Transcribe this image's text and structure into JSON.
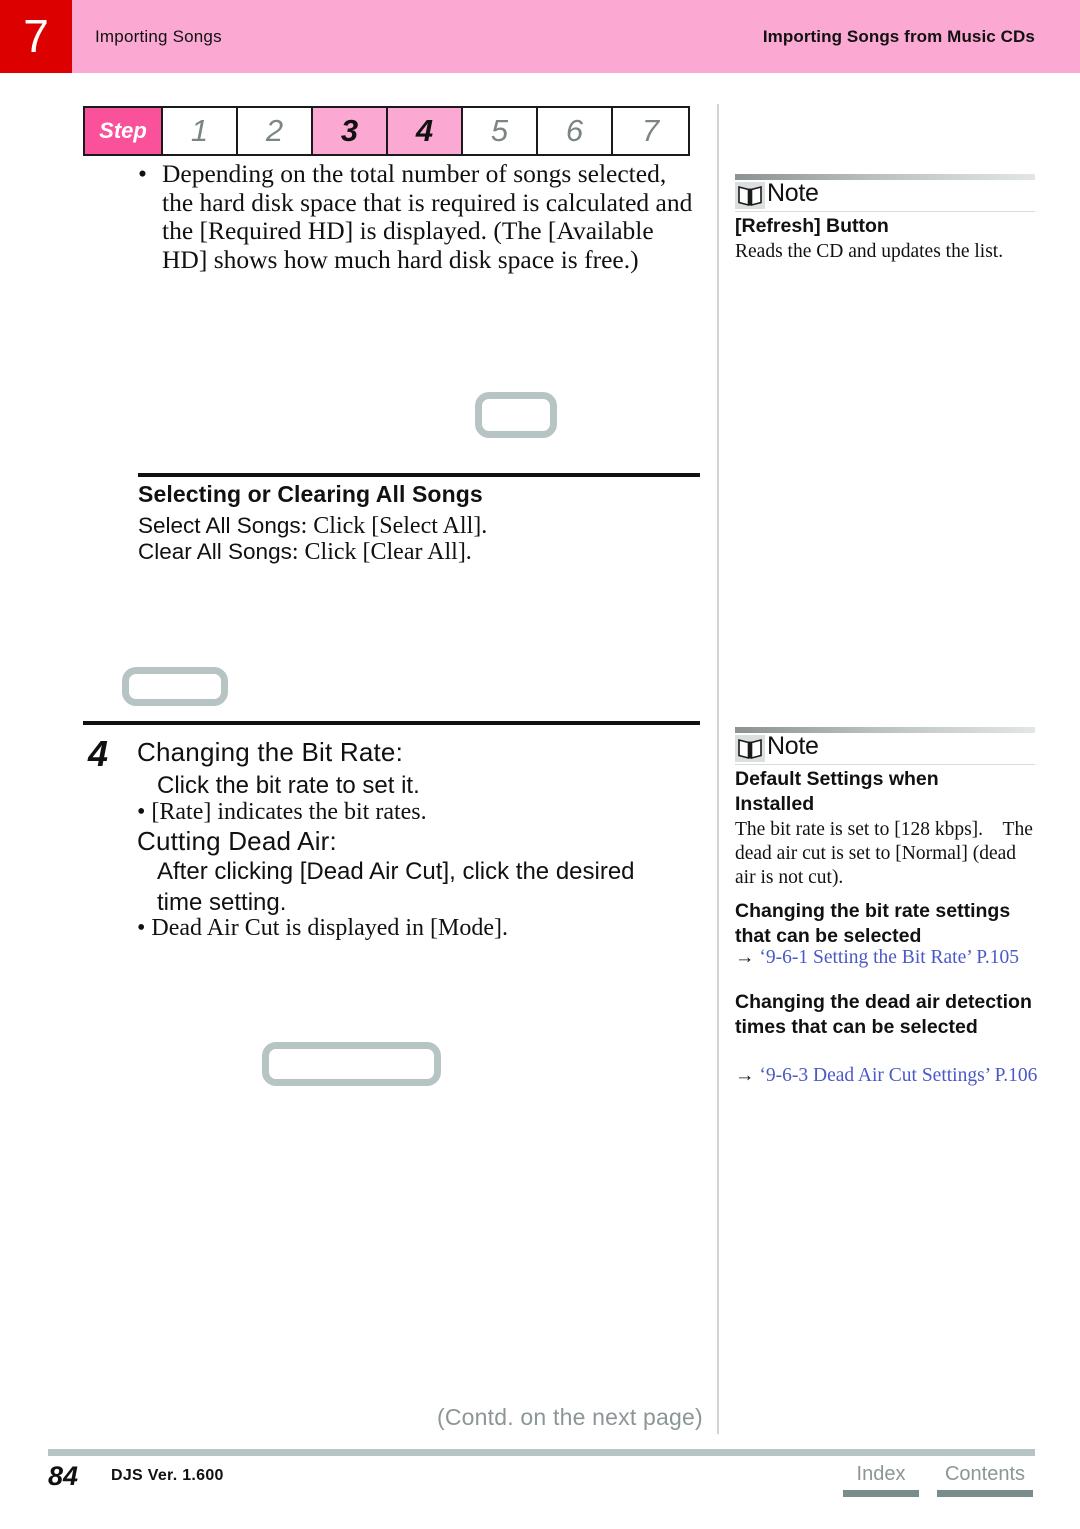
{
  "header": {
    "chapter_number": "7",
    "left_title": "Importing Songs",
    "right_title": "Importing Songs from Music CDs",
    "band_color": "#fba9d2",
    "chapter_box_color": "#dd0000"
  },
  "step_bar": {
    "label": "Step",
    "label_color": "#f9529b",
    "active_color": "#fba9d2",
    "steps": [
      {
        "number": "1",
        "active": false
      },
      {
        "number": "2",
        "active": false
      },
      {
        "number": "3",
        "active": true
      },
      {
        "number": "4",
        "active": true
      },
      {
        "number": "5",
        "active": false
      },
      {
        "number": "6",
        "active": false
      },
      {
        "number": "7",
        "active": false
      }
    ]
  },
  "main": {
    "intro_bullet": {
      "marker": "•",
      "text": "Depending on the total number of songs selected, the hard disk space that is required is calculated and the [Required HD] is displayed. (The [Available HD] shows how much hard disk space is free.)"
    },
    "section_all_songs": {
      "heading": "Selecting or Clearing All Songs",
      "lines": [
        {
          "bold_part": "Select All Songs",
          "rest": ": Click [Select All]."
        },
        {
          "bold_part": "Clear All Songs",
          "rest": ": Click [Clear All]."
        }
      ]
    },
    "step_four": {
      "number": "4",
      "title_bit_rate": "Changing the Bit Rate:",
      "body_bit_rate": "Click the bit rate to set it.",
      "bullet_bit_rate": "• [Rate] indicates the bit rates.",
      "title_dead_air": "Cutting Dead Air:",
      "body_dead_air": "After clicking [Dead Air Cut], click the desired time setting.",
      "bullet_dead_air": "• Dead Air Cut is displayed in [Mode]."
    },
    "placeholder_color": "#b6c4c4"
  },
  "notes": [
    {
      "icon": "open-book-icon",
      "head_label": "Note",
      "subheading": "[Refresh] Button",
      "body": "Reads the CD and updates the list."
    },
    {
      "icon": "open-book-icon",
      "head_label": "Note",
      "subheading": "Default Settings when Installed",
      "body": "The bit rate is set to [128 kbps]. The dead air cut is set to [Normal] (dead air is not cut).",
      "subheading2": "Changing the bit rate settings that can be selected",
      "link2_arrow": "→",
      "link2_text": "‘9-6-1 Setting the Bit Rate’",
      "link2_page": "P.105",
      "subheading3": "Changing the dead air detection times that can be selected",
      "link3_arrow": "→",
      "link3_text": "‘9-6-3 Dead Air Cut Settings’",
      "link3_page": "P.106",
      "link_color": "#4a58c8"
    }
  ],
  "footer": {
    "contd": "(Contd. on the next page)",
    "page_number": "84",
    "version": "DJS Ver. 1.600",
    "index_label": "Index",
    "contents_label": "Contents",
    "accent_color": "#7a8c8c"
  }
}
